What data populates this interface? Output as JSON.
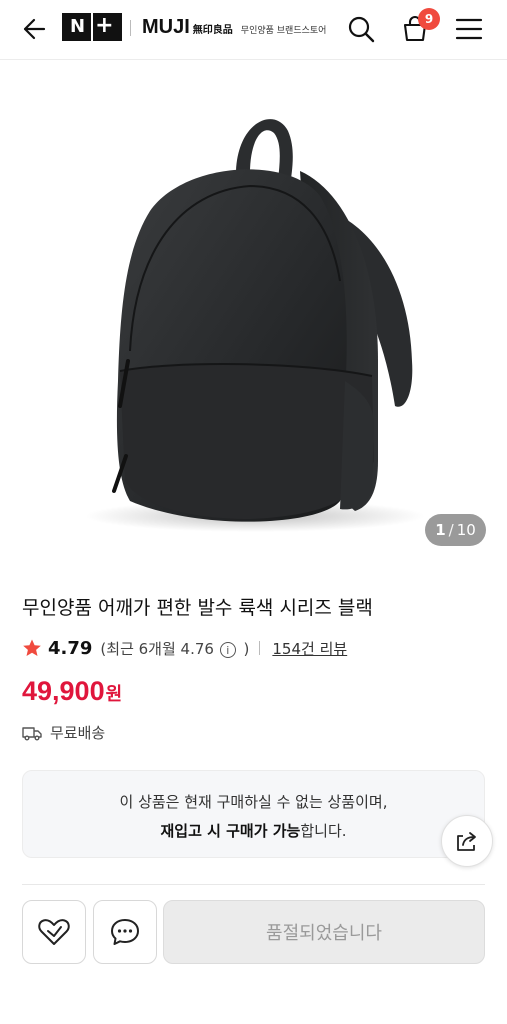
{
  "header": {
    "logo_n": "N",
    "logo_plus": "+",
    "brand_name": "MUJI",
    "brand_kanji": "無印良品",
    "brand_sub": "무인양품 브랜드스토어",
    "cart_count": "9"
  },
  "gallery": {
    "current": "1",
    "separator": "/",
    "total": "10"
  },
  "product": {
    "title": "무인양품 어깨가 편한 발수 륙색 시리즈 블랙",
    "rating": "4.79",
    "recent_rating_prefix": "(최근 6개월 4.76",
    "info_glyph": "i",
    "recent_rating_suffix": ")",
    "review_count_label": "154건 리뷰",
    "price": "49,900",
    "currency": "원",
    "shipping": "무료배송"
  },
  "notice": {
    "line1": "이 상품은 현재 구매하실 수 없는 상품이며,",
    "line2_bold": "재입고 시 구매가 가능",
    "line2_rest": "합니다."
  },
  "actions": {
    "soldout_label": "품절되었습니다"
  },
  "colors": {
    "accent_red": "#e0163c",
    "star": "#f04a3e",
    "badge": "#f04a3e"
  }
}
